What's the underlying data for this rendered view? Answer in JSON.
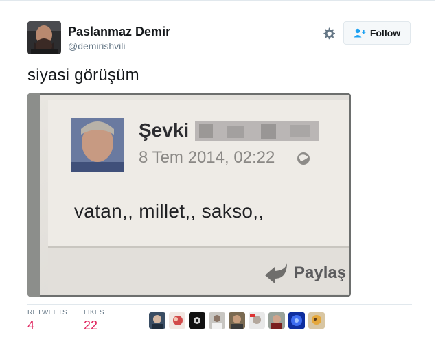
{
  "user": {
    "name": "Paslanmaz Demir",
    "handle": "@demirishvili"
  },
  "follow_label": "Follow",
  "tweet": {
    "text": "siyasi görüşüm"
  },
  "screenshot": {
    "author": "Şevki",
    "date": "8 Tem 2014, 02:22",
    "post_text": "vatan,, millet,, sakso,,",
    "share_label": "Paylaş"
  },
  "stats": {
    "retweets_label": "RETWEETS",
    "retweets_value": "4",
    "likes_label": "LIKES",
    "likes_value": "22"
  },
  "colors": {
    "accent_red": "#e0245e",
    "muted": "#657786",
    "border": "#e1e8ed"
  },
  "icons": {
    "gear": "gear-icon",
    "follow": "user-plus-icon",
    "globe": "globe-icon",
    "share": "share-arrow-icon"
  }
}
